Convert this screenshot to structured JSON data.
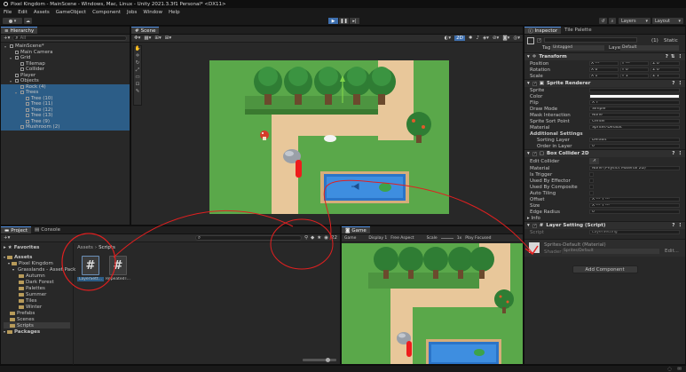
{
  "titlebar": {
    "text": "Pixel Kingdom - MainScene - Windows, Mac, Linux - Unity 2021.3.3f1 Personal* <DX11>"
  },
  "menu": [
    "File",
    "Edit",
    "Assets",
    "GameObject",
    "Component",
    "Jobs",
    "Window",
    "Help"
  ],
  "toolbar": {
    "account_label": "",
    "layers_label": "Layers",
    "layout_label": "Layout"
  },
  "hierarchy": {
    "tab": "Hierarchy",
    "search_placeholder": "All",
    "items": [
      {
        "label": "MainScene*",
        "depth": 0,
        "selected": false
      },
      {
        "label": "Main Camera",
        "depth": 1,
        "selected": false
      },
      {
        "label": "Grid",
        "depth": 1,
        "selected": false
      },
      {
        "label": "Tilemap",
        "depth": 2,
        "selected": false
      },
      {
        "label": "Collider",
        "depth": 2,
        "selected": false
      },
      {
        "label": "Player",
        "depth": 1,
        "selected": false
      },
      {
        "label": "Objects",
        "depth": 1,
        "selected": false
      },
      {
        "label": "Rock (4)",
        "depth": 2,
        "selected": true
      },
      {
        "label": "Trees",
        "depth": 2,
        "selected": true
      },
      {
        "label": "Tree (10)",
        "depth": 3,
        "selected": true
      },
      {
        "label": "Tree (11)",
        "depth": 3,
        "selected": true
      },
      {
        "label": "Tree (12)",
        "depth": 3,
        "selected": true
      },
      {
        "label": "Tree (13)",
        "depth": 3,
        "selected": true
      },
      {
        "label": "Tree (9)",
        "depth": 3,
        "selected": true
      },
      {
        "label": "Mushroom (2)",
        "depth": 2,
        "selected": true
      }
    ]
  },
  "scene": {
    "tab": "Scene",
    "mode_2d": "2D"
  },
  "inspector": {
    "tabs": [
      "Inspector",
      "Tile Palette"
    ],
    "static_label": "Static",
    "count": "(1)",
    "tag_label": "Tag",
    "tag_value": "Untagged",
    "layer_label": "Layer",
    "layer_value": "Default",
    "transform": {
      "title": "Transform",
      "rows": [
        {
          "label": "Position",
          "x": "X ---",
          "y": "Y ---",
          "z": "Z 0"
        },
        {
          "label": "Rotation",
          "x": "X 0",
          "y": "Y 0",
          "z": "Z 0"
        },
        {
          "label": "Scale",
          "x": "X 1",
          "y": "Y 1",
          "z": "Z 1"
        }
      ]
    },
    "sprite_renderer": {
      "title": "Sprite Renderer",
      "rows": [
        {
          "label": "Sprite",
          "value": ""
        },
        {
          "label": "Color",
          "value": ""
        },
        {
          "label": "Flip",
          "value": "X   Y"
        },
        {
          "label": "Draw Mode",
          "value": "Simple"
        },
        {
          "label": "Mask Interaction",
          "value": "None"
        },
        {
          "label": "Sprite Sort Point",
          "value": "Center"
        },
        {
          "label": "Material",
          "value": "Sprites-Default"
        }
      ],
      "additional_settings": "Additional Settings",
      "sorting_layer_label": "Sorting Layer",
      "sorting_layer_value": "Default",
      "order_label": "Order in Layer",
      "order_value": "0"
    },
    "box_collider": {
      "title": "Box Collider 2D",
      "edit_collider": "Edit Collider",
      "rows": [
        {
          "label": "Material",
          "value": "None (Physics Material 2D)"
        },
        {
          "label": "Is Trigger",
          "value": ""
        },
        {
          "label": "Used By Effector",
          "value": ""
        },
        {
          "label": "Used By Composite",
          "value": ""
        },
        {
          "label": "Auto Tiling",
          "value": ""
        },
        {
          "label": "Offset",
          "value": "X ---     Y ---"
        },
        {
          "label": "Size",
          "value": "X ---     Y ---"
        },
        {
          "label": "Edge Radius",
          "value": "0"
        }
      ],
      "info": "Info"
    },
    "layer_setting": {
      "title": "Layer Setting (Script)",
      "script_label": "Script",
      "script_value": "LayerSetting"
    },
    "material": {
      "name": "Sprites-Default (Material)",
      "shader_label": "Shader",
      "shader_value": "Sprites/Default",
      "edit": "Edit..."
    },
    "add_component": "Add Component"
  },
  "project": {
    "tabs": [
      "Project",
      "Console"
    ],
    "favorites": "Favorites",
    "tree": [
      {
        "label": "Assets",
        "depth": 0
      },
      {
        "label": "Pixel Kingdom",
        "depth": 1
      },
      {
        "label": "Grasslands - Asset Pack",
        "depth": 2
      },
      {
        "label": "Autumn",
        "depth": 3
      },
      {
        "label": "Dark Forest",
        "depth": 3
      },
      {
        "label": "Palettes",
        "depth": 3
      },
      {
        "label": "Summer",
        "depth": 3
      },
      {
        "label": "Tiles",
        "depth": 3
      },
      {
        "label": "Winter",
        "depth": 3
      },
      {
        "label": "Prefabs",
        "depth": 1
      },
      {
        "label": "Scenes",
        "depth": 1
      },
      {
        "label": "Scripts",
        "depth": 1
      },
      {
        "label": "Packages",
        "depth": 0
      }
    ],
    "breadcrumb": [
      "Assets",
      "Scripts"
    ],
    "assets": [
      {
        "name": "LayerSett...",
        "selected": true
      },
      {
        "name": "RepeatedT...",
        "selected": false
      }
    ],
    "icon_count": "22"
  },
  "game": {
    "tab": "Game",
    "display": "Game",
    "display_num": "Display 1",
    "aspect": "Free Aspect",
    "scale_label": "Scale",
    "scale_value": "1x",
    "play_focused": "Play Focused"
  },
  "colors": {
    "selection": "#2c5d87",
    "accent": "#4f8ee0",
    "annotation": "#e02020"
  }
}
